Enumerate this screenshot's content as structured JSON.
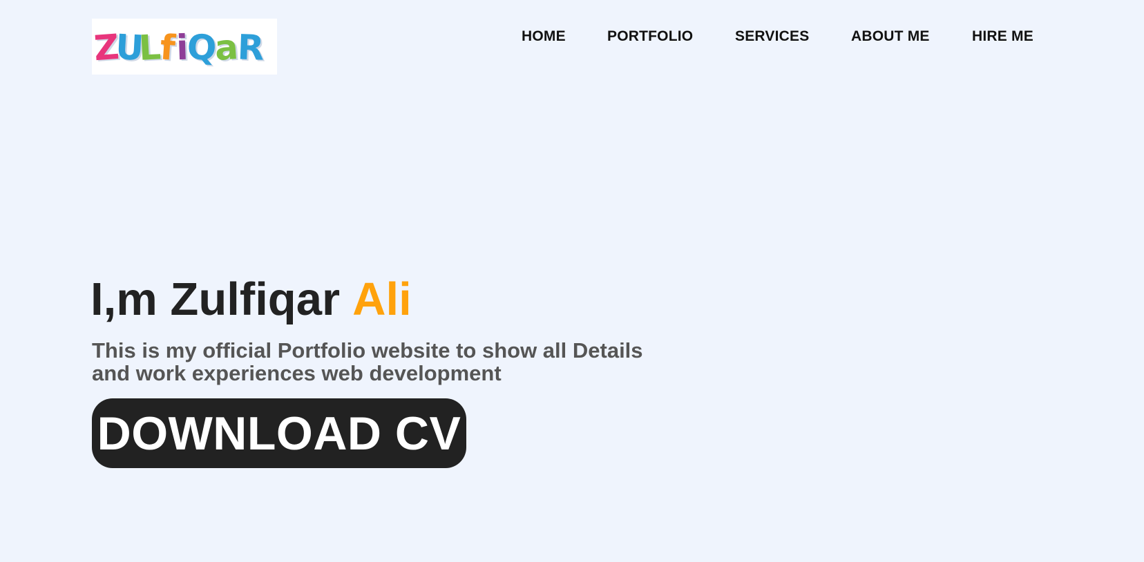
{
  "header": {
    "logo": {
      "text": "ZULfiQaR",
      "letter_colors": [
        "#e8357c",
        "#2d9fd9",
        "#7bc043",
        "#f7941d",
        "#8e3e97",
        "#2d9fd9",
        "#7bc043",
        "#2d9fd9"
      ]
    },
    "nav": [
      {
        "label": "HOME"
      },
      {
        "label": "PORTFOLIO"
      },
      {
        "label": "SERVICES"
      },
      {
        "label": "ABOUT ME"
      },
      {
        "label": "HIRE ME"
      }
    ]
  },
  "hero": {
    "title_prefix": "I,m Zulfiqar",
    "title_highlight": "Ali",
    "description": "This is my official Portfolio website to show all Details and work experiences web development",
    "cta_label": "DOWNLOAD CV"
  },
  "colors": {
    "background": "#eff4fd",
    "accent": "#ffa20c",
    "text_dark": "#222222",
    "text_muted": "#555555",
    "button_bg": "#222222",
    "button_text": "#ffffff"
  }
}
